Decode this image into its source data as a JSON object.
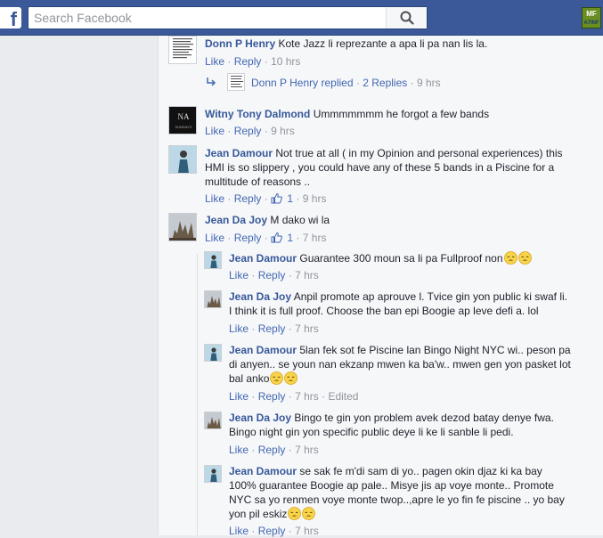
{
  "header": {
    "logo_letter": "f",
    "search_placeholder": "Search Facebook",
    "app_icon_top": "MF",
    "app_icon_bottom": "A7INF"
  },
  "colors": {
    "brand": "#3b5998",
    "link": "#4267b2",
    "author": "#365899",
    "meta": "#90949c"
  },
  "comments": [
    {
      "author": "Donn P Henry",
      "text": "Kote Jazz li reprezante a apa li pa nan lis la.",
      "like": "Like",
      "reply": "Reply",
      "time": "10 hrs"
    },
    {
      "author": "Donn P Henry",
      "replied": "replied",
      "replies": "2 Replies",
      "time": "9 hrs"
    },
    {
      "author": "Witny Tony Dalmond",
      "text": "Ummmmmmm he forgot a few bands",
      "like": "Like",
      "reply": "Reply",
      "time": "9 hrs"
    },
    {
      "author": "Jean Damour",
      "text": "Not true at all ( in my Opinion and personal experiences) this HMI is so slippery , you could have any of these 5 bands in a Piscine for a multitude of reasons ..",
      "like": "Like",
      "reply": "Reply",
      "likes": "1",
      "time": "9 hrs"
    },
    {
      "author": "Jean Da Joy",
      "text": "M dako wi la",
      "like": "Like",
      "reply": "Reply",
      "likes": "1",
      "time": "7 hrs"
    }
  ],
  "replies": [
    {
      "author": "Jean Damour",
      "text": "Guarantee 300 moun sa li pa Fullproof non",
      "like": "Like",
      "reply": "Reply",
      "time": "7 hrs"
    },
    {
      "author": "Jean Da Joy",
      "text": "Anpil promote ap aprouve l. Tvice gin yon public ki swaf li. I think it is full proof. Choose the ban epi Boogie ap leve defi a. lol",
      "like": "Like",
      "reply": "Reply",
      "time": "7 hrs"
    },
    {
      "author": "Jean Damour",
      "text": "5lan fek sot fe Piscine lan Bingo Night NYC wi.. peson pa di anyen.. se youn nan ekzanp mwen ka ba'w.. mwen gen yon pasket lot bal anko",
      "like": "Like",
      "reply": "Reply",
      "time": "7 hrs",
      "edited": "Edited"
    },
    {
      "author": "Jean Da Joy",
      "text": "Bingo te gin yon problem avek dezod batay denye fwa. Bingo night gin yon specific public deye li ke li sanble li pedi.",
      "like": "Like",
      "reply": "Reply",
      "time": "7 hrs"
    },
    {
      "author": "Jean Damour",
      "text": "se sak fe m'di sam di yo.. pagen okin djaz ki ka bay 100% guarantee Boogie ap pale.. Misye jis ap voye monte.. Promote NYC sa yo renmen voye monte twop..,apre le yo fin fe piscine .. yo bay yon pil eskiz",
      "like": "Like",
      "reply": "Reply",
      "time": "7 hrs"
    }
  ],
  "avatar_text": {
    "witny_line1": "NA",
    "witny_line2": "SUNDAYS"
  }
}
